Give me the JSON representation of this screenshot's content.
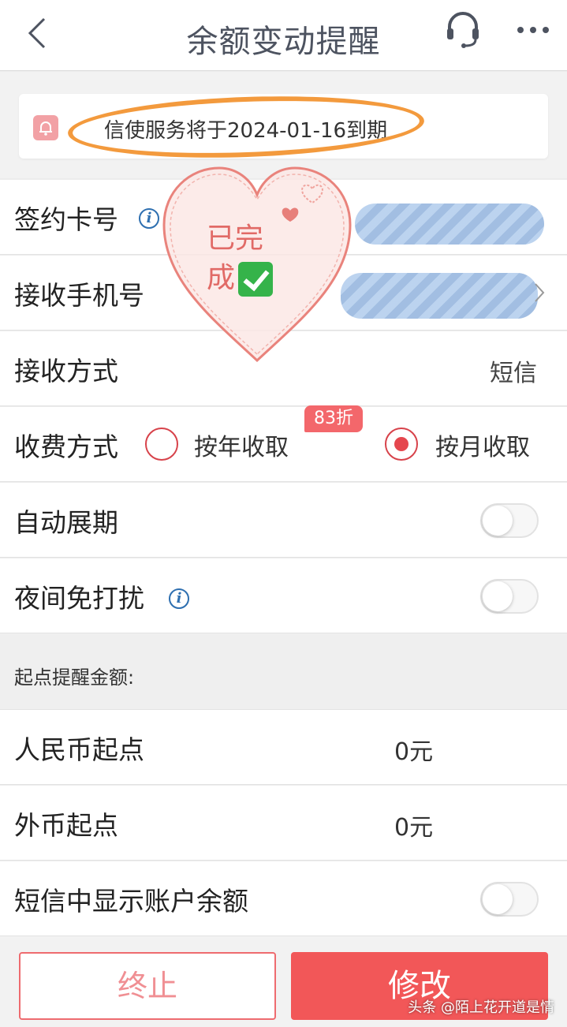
{
  "header": {
    "title": "余额变动提醒",
    "back_icon": "chevron-left-icon",
    "service_icon": "headset-icon",
    "more_icon": "more-dots-icon"
  },
  "notice": {
    "text": "信使服务将于2024-01-16到期",
    "icon": "bell-icon",
    "ring_color": "#f39a3d"
  },
  "sticker": {
    "line1": "已完",
    "line2": "成"
  },
  "rows": {
    "card": {
      "label": "签约卡号"
    },
    "phone": {
      "label": "接收手机号"
    },
    "method": {
      "label": "接收方式",
      "value": "短信"
    },
    "fee": {
      "label": "收费方式",
      "option_year": "按年收取",
      "badge": "83折",
      "option_month": "按月收取",
      "selected": "按月收取"
    },
    "auto_renew": {
      "label": "自动展期",
      "on": false
    },
    "night": {
      "label": "夜间免打扰",
      "on": false
    }
  },
  "section": {
    "title": "起点提醒金额:"
  },
  "amounts": {
    "rmb": {
      "label": "人民币起点",
      "value": "0元"
    },
    "foreign": {
      "label": "外币起点",
      "value": "0元"
    }
  },
  "sms_balance": {
    "label": "短信中显示账户余额",
    "on": false
  },
  "buttons": {
    "stop": "终止",
    "edit": "修改"
  },
  "watermark": "头条 @陌上花开道是情",
  "colors": {
    "accent_red": "#f25758",
    "info_blue": "#2e6fb0"
  }
}
